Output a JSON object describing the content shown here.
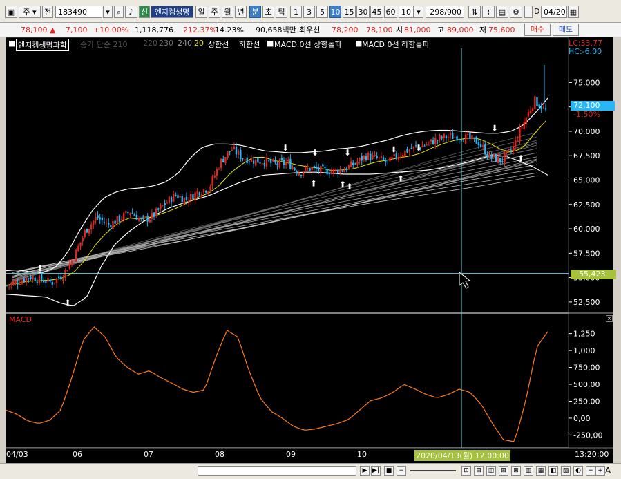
{
  "toolbar": {
    "period": "주",
    "prev_label": "전",
    "code": "183490",
    "new_badge": "신",
    "stock_name": "엔지켐생명",
    "periods": [
      "일",
      "주",
      "월",
      "년",
      "분",
      "초",
      "틱"
    ],
    "selected_period": "분",
    "intervals": [
      "1",
      "3",
      "5",
      "10",
      "15",
      "30",
      "45",
      "60"
    ],
    "selected_interval": "10",
    "count_value": "10",
    "page_count": "298/900",
    "date_check_label": "D",
    "date_value": "04/20"
  },
  "quote": {
    "price": "78,100",
    "change": "7,100",
    "change_pct": "+10.00%",
    "volume": "1,118,776",
    "vol_ratio": "212.37%",
    "turnover": "14.23%",
    "amount": "90,658백만",
    "best_label": "최우선",
    "ask": "78,200",
    "bid": "78,100",
    "open_label": "시",
    "open": "81,000",
    "high_label": "고",
    "high": "89,000",
    "low_label": "저",
    "low": "75,600",
    "buy_btn": "매수",
    "sell_btn": "매도"
  },
  "legend": {
    "stock": "엔지켐생명과학",
    "ma_text": "종가 단순 210",
    "ma_220": "220",
    "ma_230": "230",
    "ma_240": "240",
    "ma_20": "20",
    "upper": "상한선",
    "lower": "하한선",
    "macd_up": "MACD 0선 상향돌파",
    "macd_down": "MACD 0선 하향돌파",
    "lc": "LC:33.77",
    "hc": "HC:-6.00",
    "price_tag": "72,100",
    "price_pct": "-1.50%",
    "cross_tag": "55,423"
  },
  "colors": {
    "up": "#e0261d",
    "down": "#29b6f6",
    "macd": "#ff7a1a",
    "ma20": "#e6e600",
    "band": "#ffffff",
    "crosshair": "#6fd0e0",
    "price_tag_bg": "#29b6f6",
    "cross_tag_bg": "#a5c23a"
  },
  "macd_panel": {
    "title": "MACD"
  },
  "time_axis": {
    "labels": [
      "04/03",
      "06",
      "07",
      "08",
      "09",
      "10"
    ],
    "cursor_label": "2020/04/13(월) 12:00:00",
    "clock": "13:20:00"
  },
  "chart_data": [
    {
      "type": "candlestick",
      "title": "엔지켐생명과학",
      "yticks": [
        52500,
        55000,
        57500,
        60000,
        62500,
        65000,
        67500,
        70000,
        72500,
        75000
      ],
      "ytick_labels": [
        "52,500",
        "55,000",
        "57,500",
        "60,000",
        "62,500",
        "65,000",
        "67,500",
        "70,000",
        "72,500",
        "75,000"
      ],
      "ylim": [
        51500,
        78500
      ],
      "x_labels": [
        "04/03",
        "06",
        "07",
        "08",
        "09",
        "10"
      ],
      "close_trend": [
        54200,
        54600,
        55100,
        54800,
        54500,
        55300,
        57200,
        59800,
        61200,
        60400,
        61000,
        61800,
        60800,
        61300,
        62500,
        63500,
        63000,
        63800,
        64200,
        66800,
        68200,
        67300,
        67000,
        66900,
        66600,
        66800,
        65800,
        66200,
        66000,
        65900,
        66100,
        66700,
        67500,
        67200,
        66800,
        67700,
        68200,
        68500,
        69000,
        69400,
        69500,
        69300,
        68900,
        67400,
        67000,
        68100,
        70800,
        73200,
        72100
      ],
      "upper_band": [
        55700,
        55800,
        55600,
        55500,
        56000,
        57500,
        59800,
        61800,
        63200,
        63800,
        64100,
        64200,
        64400,
        64800,
        65700,
        67300,
        68400,
        68700,
        68700,
        68600,
        68300,
        68000,
        67900,
        67800,
        67800,
        67900,
        68000,
        68200,
        68300,
        68500,
        68800,
        69100,
        69500,
        69800,
        70000,
        70100,
        70100,
        70000,
        69900,
        69800,
        69800,
        70000,
        70600,
        71900,
        73400
      ],
      "lower_band": [
        53300,
        53200,
        53100,
        53000,
        52400,
        52100,
        53000,
        56000,
        58300,
        59600,
        60600,
        61400,
        62100,
        62600,
        63000,
        63400,
        64000,
        64600,
        65100,
        65500,
        65600,
        65700,
        65800,
        65800,
        65700,
        65600,
        65600,
        65600,
        65700,
        65800,
        65900,
        66000,
        66200,
        66500,
        66800,
        67200,
        67600,
        67400,
        66900,
        66300,
        65500
      ],
      "macd": [
        120,
        60,
        -40,
        -80,
        -30,
        120,
        600,
        1150,
        1350,
        1200,
        900,
        750,
        650,
        700,
        600,
        520,
        430,
        380,
        420,
        900,
        1300,
        1200,
        700,
        300,
        100,
        0,
        -120,
        -180,
        -160,
        -120,
        -80,
        -20,
        120,
        260,
        300,
        380,
        500,
        430,
        350,
        300,
        350,
        430,
        380,
        200,
        -80,
        -320,
        -350,
        250,
        1050,
        1280
      ],
      "macd_yticks": [
        -250,
        0,
        250,
        500,
        750,
        1000,
        1250
      ],
      "macd_ytick_labels": [
        "-250,00",
        "0,00",
        "250,00",
        "500,00",
        "750,00",
        "1,000",
        "1,250"
      ]
    }
  ]
}
